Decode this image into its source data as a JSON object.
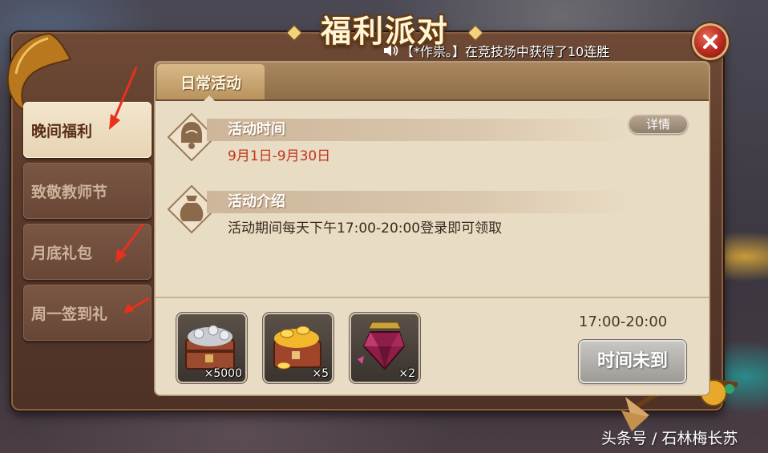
{
  "window": {
    "title": "福利派对",
    "close_icon": "close-x-icon"
  },
  "broadcast": {
    "icon": "speaker-icon",
    "text": "【*作祟。】在竞技场中获得了10连胜"
  },
  "sidebar": {
    "items": [
      {
        "label": "晚间福利",
        "active": true
      },
      {
        "label": "致敬教师节",
        "active": false
      },
      {
        "label": "月底礼包",
        "active": false
      },
      {
        "label": "周一签到礼",
        "active": false
      }
    ]
  },
  "tabs": [
    {
      "label": "日常活动",
      "active": true
    }
  ],
  "activity": {
    "time_section": {
      "icon": "bell-icon",
      "header": "活动时间",
      "value": "9月1日-9月30日",
      "value_color": "#c0351c"
    },
    "details_button": "详情",
    "intro_section": {
      "icon": "pouch-icon",
      "header": "活动介绍",
      "value": "活动期间每天下午17:00-20:00登录即可领取"
    },
    "rewards": [
      {
        "icon": "silver-chest-icon",
        "quantity": "×5000"
      },
      {
        "icon": "gold-chest-icon",
        "quantity": "×5"
      },
      {
        "icon": "gem-icon",
        "quantity": "×2"
      }
    ],
    "time_range": "17:00-20:00",
    "claim_button": "时间未到"
  },
  "watermark": "头条号 / 石林梅长苏",
  "colors": {
    "accent_red": "#c0351c",
    "annotation_arrow": "#e8301e"
  }
}
